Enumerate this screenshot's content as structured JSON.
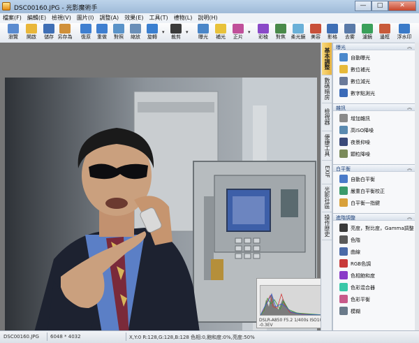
{
  "window": {
    "title": "DSC00160.JPG - 光影魔術手",
    "minimize": "—",
    "maximize": "□",
    "close": "✕"
  },
  "menu": [
    "檔案(F)",
    "編輯(E)",
    "檢視(V)",
    "圖片(I)",
    "調整(A)",
    "效果(E)",
    "工具(T)",
    "禮物(L)",
    "說明(H)"
  ],
  "toolbar": [
    {
      "label": "瀏覽",
      "icon": "browse-icon",
      "color": "#5a8bd0"
    },
    {
      "label": "開啟",
      "icon": "folder-open-icon",
      "color": "#e9b73a"
    },
    {
      "label": "儲存",
      "icon": "save-icon",
      "color": "#3f6fb5"
    },
    {
      "label": "另存為",
      "icon": "save-as-icon",
      "color": "#d0903a"
    },
    {
      "label": "復原",
      "icon": "undo-icon",
      "color": "#3f7fd0"
    },
    {
      "label": "重做",
      "icon": "redo-icon",
      "color": "#3f7fd0"
    },
    {
      "label": "對照",
      "icon": "compare-icon",
      "color": "#5a93c8"
    },
    {
      "label": "縮放",
      "icon": "zoom-icon",
      "color": "#6a8fb8"
    },
    {
      "label": "旋轉",
      "icon": "rotate-icon",
      "color": "#3a7fd0"
    },
    {
      "label": "裁剪",
      "icon": "crop-icon",
      "color": "#3b3b3b"
    },
    {
      "label": "曝光",
      "icon": "exposure-icon",
      "color": "#4a86c8"
    },
    {
      "label": "補光",
      "icon": "fill-light-icon",
      "color": "#e8c23a"
    },
    {
      "label": "正片",
      "icon": "film-icon",
      "color": "#c0509a"
    },
    {
      "label": "彩稜",
      "icon": "magic-wand-icon",
      "color": "#8a4ac8"
    },
    {
      "label": "對焦",
      "icon": "focus-icon",
      "color": "#4a8a4a"
    },
    {
      "label": "柔光鏡",
      "icon": "soft-lens-icon",
      "color": "#6ab0d8"
    },
    {
      "label": "美容",
      "icon": "beauty-icon",
      "color": "#c8503a"
    },
    {
      "label": "影格",
      "icon": "frame-icon",
      "color": "#3f6fb5"
    },
    {
      "label": "去雾",
      "icon": "dehaze-icon",
      "color": "#5a7aa8"
    },
    {
      "label": "濾鏡",
      "icon": "filter-icon",
      "color": "#3aa05a"
    },
    {
      "label": "邊框",
      "icon": "border-icon",
      "color": "#c85a3a"
    },
    {
      "label": "浮水印",
      "icon": "watermark-icon",
      "color": "#3a7ac8"
    }
  ],
  "side_tabs": [
    {
      "label": "基本調整",
      "active": true
    },
    {
      "label": "數碼暗房",
      "active": false
    },
    {
      "label": "檢視器",
      "active": false
    },
    {
      "label": "便捷工具",
      "active": false
    },
    {
      "label": "EXIF",
      "active": false
    },
    {
      "label": "光影社區",
      "active": false
    },
    {
      "label": "操作歷史",
      "active": false
    }
  ],
  "panel": {
    "sections": [
      {
        "title": "曝光",
        "items": [
          {
            "label": "自動曝光",
            "icon": "auto-exposure-icon",
            "color": "#4a88cc"
          },
          {
            "label": "數位補光",
            "icon": "digital-fill-icon",
            "color": "#e7b93a"
          },
          {
            "label": "數位減光",
            "icon": "digital-reduce-icon",
            "color": "#6a7a9a"
          },
          {
            "label": "數字點測光",
            "icon": "spot-meter-icon",
            "color": "#3a6ab8"
          }
        ]
      },
      {
        "title": "雜訊",
        "items": [
          {
            "label": "增加雜訊",
            "icon": "add-noise-icon",
            "color": "#8a8a8a"
          },
          {
            "label": "高ISO降噪",
            "icon": "iso-denoise-icon",
            "color": "#5a8ab0"
          },
          {
            "label": "夜景抑噪",
            "icon": "night-denoise-icon",
            "color": "#3a4a7a"
          },
          {
            "label": "顆粒降噪",
            "icon": "grain-denoise-icon",
            "color": "#7a8a5a"
          }
        ]
      },
      {
        "title": "白平衡",
        "items": [
          {
            "label": "自動白平衡",
            "icon": "auto-wb-icon",
            "color": "#4a7ac8"
          },
          {
            "label": "嚴重白平衡校正",
            "icon": "wb-correct-icon",
            "color": "#3a9a6a"
          },
          {
            "label": "白平衡一指鍵",
            "icon": "wb-one-click-icon",
            "color": "#d8a03a"
          }
        ]
      },
      {
        "title": "進階調整",
        "items": [
          {
            "label": "亮度，對比度，Gamma調整",
            "icon": "brightness-icon",
            "color": "#3a3a3a"
          },
          {
            "label": "色階",
            "icon": "levels-icon",
            "color": "#5a5a5a"
          },
          {
            "label": "曲線",
            "icon": "curves-icon",
            "color": "#4a6aa8"
          },
          {
            "label": "RGB色調",
            "icon": "rgb-icon",
            "color": "#c83a3a"
          },
          {
            "label": "色相飽和度",
            "icon": "hue-sat-icon",
            "color": "#8a3ac8"
          },
          {
            "label": "色彩混合器",
            "icon": "color-mixer-icon",
            "color": "#3ac8a8"
          },
          {
            "label": "色彩平衡",
            "icon": "color-balance-icon",
            "color": "#c85a8a"
          },
          {
            "label": "模糊",
            "icon": "blur-icon",
            "color": "#6a7a8a"
          }
        ]
      }
    ]
  },
  "histogram": {
    "close": "✕",
    "info": "DSLR-A850 F5.2 1/400s ISO1000 -0.3EV"
  },
  "status": {
    "filename": "DSC00160.JPG",
    "dimensions": "6048 * 4032",
    "pixel_info": "X,Y:0 R:128,G:128,B:128 色相:0,飽和度:0%,亮度:50%"
  }
}
